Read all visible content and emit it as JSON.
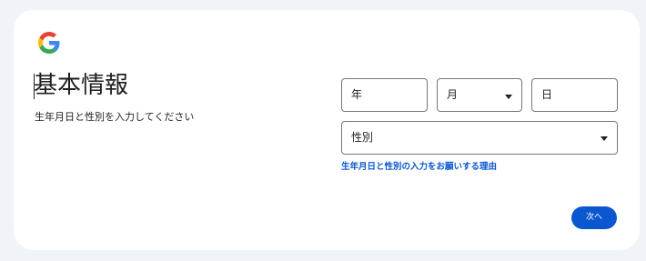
{
  "page": {
    "title": "基本情報",
    "subtitle": "生年月日と性別を入力してください"
  },
  "form": {
    "year_label": "年",
    "month_label": "月",
    "day_label": "日",
    "gender_label": "性別",
    "reason_link": "生年月日と性別の入力をお願いする理由",
    "next_button": "次へ"
  },
  "icons": {
    "logo": "google-g-logo",
    "month_dropdown": "dropdown-arrow",
    "gender_dropdown": "dropdown-arrow"
  },
  "colors": {
    "background": "#f0f4f9",
    "card": "#ffffff",
    "accent": "#0b57d0",
    "text": "#1f1f1f",
    "field_border": "#747775",
    "logo_blue": "#4285F4",
    "logo_red": "#EA4335",
    "logo_yellow": "#FBBC05",
    "logo_green": "#34A853"
  }
}
